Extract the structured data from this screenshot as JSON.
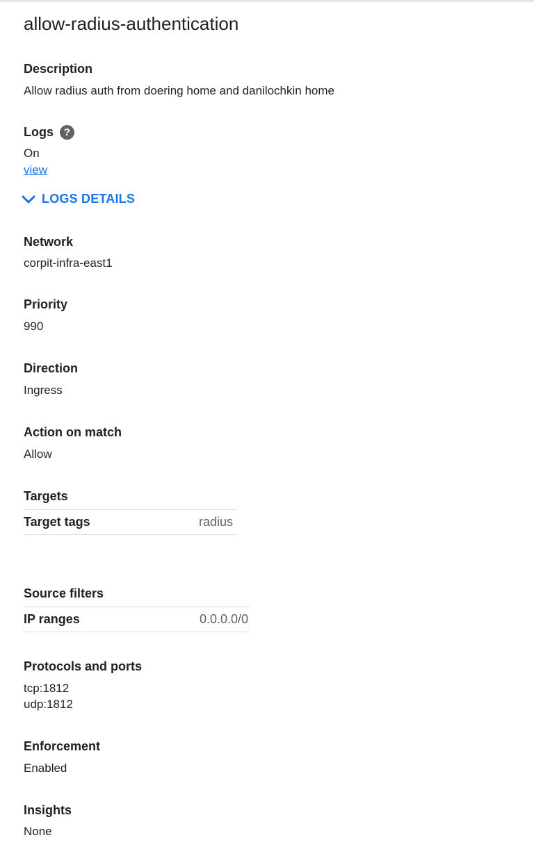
{
  "rule": {
    "name": "allow-radius-authentication"
  },
  "description": {
    "label": "Description",
    "value": "Allow radius auth from doering home and danilochkin home"
  },
  "logs": {
    "label": "Logs",
    "help_icon": "question-circle-icon",
    "value": "On",
    "view_link": "view",
    "details_toggle": "LOGS DETAILS"
  },
  "network": {
    "label": "Network",
    "value": "corpit-infra-east1"
  },
  "priority": {
    "label": "Priority",
    "value": "990"
  },
  "direction": {
    "label": "Direction",
    "value": "Ingress"
  },
  "action": {
    "label": "Action on match",
    "value": "Allow"
  },
  "targets": {
    "label": "Targets",
    "rows": [
      {
        "key": "Target tags",
        "value": "radius"
      }
    ]
  },
  "source_filters": {
    "label": "Source filters",
    "rows": [
      {
        "key": "IP ranges",
        "value": "0.0.0.0/0"
      }
    ]
  },
  "protocols": {
    "label": "Protocols and ports",
    "values": [
      "tcp:1812",
      "udp:1812"
    ]
  },
  "enforcement": {
    "label": "Enforcement",
    "value": "Enabled"
  },
  "insights": {
    "label": "Insights",
    "value": "None"
  },
  "colors": {
    "link": "#1a73e8",
    "text": "#202124",
    "secondary_text": "#5f6368",
    "divider": "#dadce0"
  }
}
